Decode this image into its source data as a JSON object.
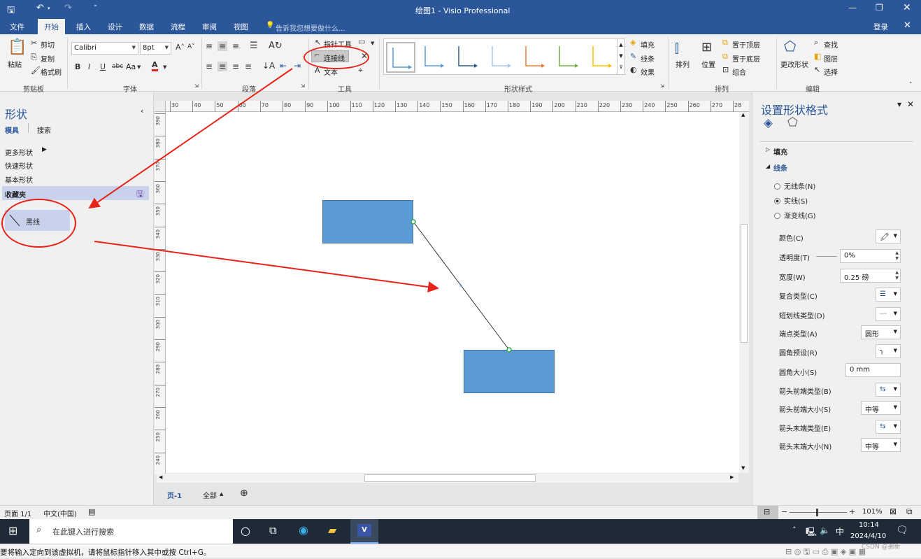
{
  "window": {
    "title": "绘图1 - Visio Professional",
    "login": "登录"
  },
  "tabs": [
    "文件",
    "开始",
    "插入",
    "设计",
    "数据",
    "流程",
    "审阅",
    "视图"
  ],
  "tellme": "告诉我您想要做什么...",
  "ribbon": {
    "clipboard": {
      "paste": "粘贴",
      "cut": "剪切",
      "copy": "复制",
      "format_painter": "格式刷",
      "group": "剪贴板"
    },
    "font": {
      "name": "Calibri",
      "size": "8pt",
      "case_label": "Aa",
      "group": "字体"
    },
    "paragraph": {
      "group": "段落"
    },
    "tools": {
      "pointer": "指针工具",
      "connector": "连接线",
      "text": "文本",
      "group": "工具"
    },
    "shape_styles": {
      "group": "形状样式",
      "fill": "填充",
      "line": "线条",
      "effects": "效果",
      "swatch_colors": [
        "#5b9bd5",
        "#5b9bd5",
        "#2e5c8a",
        "#a9c7e8",
        "#ed7d31",
        "#70ad47",
        "#ffc000"
      ]
    },
    "arrange": {
      "align": "排列",
      "position": "位置",
      "bring_front": "置于顶层",
      "send_back": "置于底层",
      "group_btn": "组合",
      "group": "排列"
    },
    "editing": {
      "change_shape": "更改形状",
      "find": "查找",
      "layers": "图层",
      "select": "选择",
      "group": "编辑"
    }
  },
  "shapes_pane": {
    "title": "形状",
    "tab_stencils": "模具",
    "tab_search": "搜索",
    "items": [
      "更多形状",
      "快速形状",
      "基本形状"
    ],
    "favorites": "收藏夹",
    "favorite_shape": "黑线"
  },
  "ruler": {
    "h_ticks": [
      "30",
      "40",
      "50",
      "60",
      "70",
      "80",
      "90",
      "100",
      "110",
      "120",
      "130",
      "140",
      "150",
      "160",
      "170",
      "180",
      "190",
      "200",
      "210",
      "220",
      "230",
      "240",
      "250",
      "260",
      "270",
      "28"
    ],
    "v_ticks": [
      "390",
      "380",
      "370",
      "360",
      "350",
      "340",
      "330",
      "320",
      "310",
      "300",
      "290",
      "280",
      "270",
      "260",
      "250",
      "240"
    ]
  },
  "page_tabs": {
    "page": "页-1",
    "all": "全部"
  },
  "format_pane": {
    "title": "设置形状格式",
    "fill": "填充",
    "line": "线条",
    "no_line": "无线条(N)",
    "solid_line": "实线(S)",
    "gradient_line": "渐变线(G)",
    "color": "颜色(C)",
    "transparency": "透明度(T)",
    "transparency_val": "0%",
    "width": "宽度(W)",
    "width_val": "0.25 磅",
    "compound": "复合类型(C)",
    "dash": "短划线类型(D)",
    "cap": "端点类型(A)",
    "cap_val": "圆形",
    "rounding_preset": "圆角预设(R)",
    "rounding_size": "圆角大小(S)",
    "rounding_size_val": "0 mm",
    "begin_arrow_type": "箭头前端类型(B)",
    "begin_arrow_size": "箭头前端大小(S)",
    "begin_arrow_size_val": "中等",
    "end_arrow_type": "箭头末端类型(E)",
    "end_arrow_size": "箭头末端大小(N)",
    "end_arrow_size_val": "中等"
  },
  "status": {
    "page": "页面 1/1",
    "lang": "中文(中国)",
    "zoom": "101%"
  },
  "taskbar": {
    "search": "在此键入进行搜索",
    "ime": "中",
    "time": "10:14",
    "date": "2024/4/10"
  },
  "vm_hint": "要将输入定向到该虚拟机，请将鼠标指针移入其中或按 Ctrl+G。",
  "watermark": "CSDN @弟新"
}
